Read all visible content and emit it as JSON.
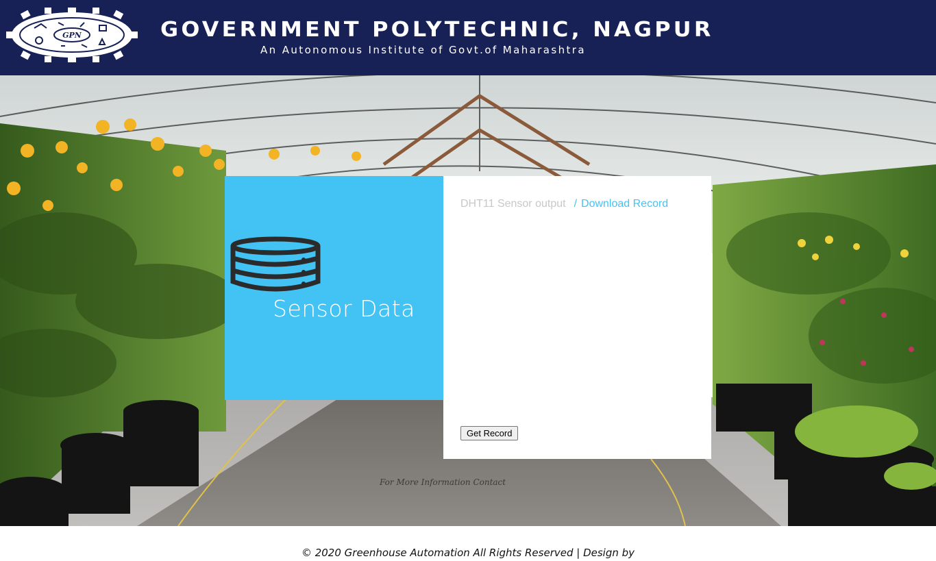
{
  "header": {
    "logo_text": "GPN",
    "institute_name": "GOVERNMENT POLYTECHNIC, NAGPUR",
    "institute_subtitle": "An Autonomous Institute of Govt.of Maharashtra"
  },
  "card": {
    "icon": "database-icon",
    "title": "Sensor Data",
    "breadcrumb": {
      "current": "DHT11 Sensor output",
      "separator": "/",
      "link": "Download Record"
    },
    "button_label": "Get Record"
  },
  "contact_text": "For More Information Contact",
  "footer": {
    "copyright": "© 2020 Greenhouse Automation All Rights Reserved | Design by"
  },
  "colors": {
    "header_bg": "#182155",
    "accent": "#42c3f4",
    "muted_text": "#c8c8c8"
  }
}
